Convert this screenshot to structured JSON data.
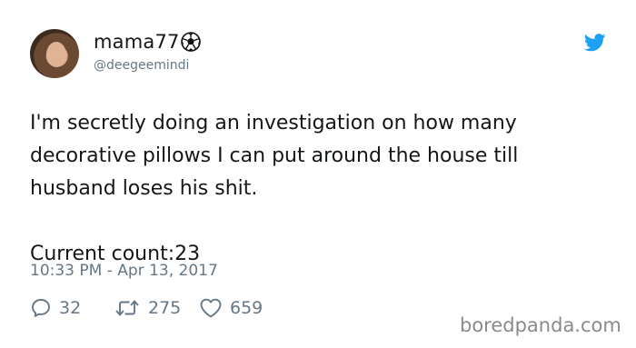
{
  "author": {
    "display_name": "mama77",
    "handle": "@deegeemindi"
  },
  "tweet": {
    "lines": [
      "I'm secretly doing an investigation on how many",
      "decorative pillows I can put around the house till",
      "husband loses his shit."
    ],
    "count_line": "Current count:23",
    "timestamp": "10:33 PM - Apr 13, 2017"
  },
  "stats": {
    "replies": "32",
    "retweets": "275",
    "likes": "659"
  },
  "icons": {
    "name_emoji": "soccer-ball-icon",
    "brand": "twitter-bird-icon",
    "reply": "reply-icon",
    "retweet": "retweet-icon",
    "like": "heart-icon"
  },
  "colors": {
    "twitter_blue": "#1da1f2",
    "text": "#14171a",
    "secondary": "#657786"
  },
  "watermark": "boredpanda.com"
}
